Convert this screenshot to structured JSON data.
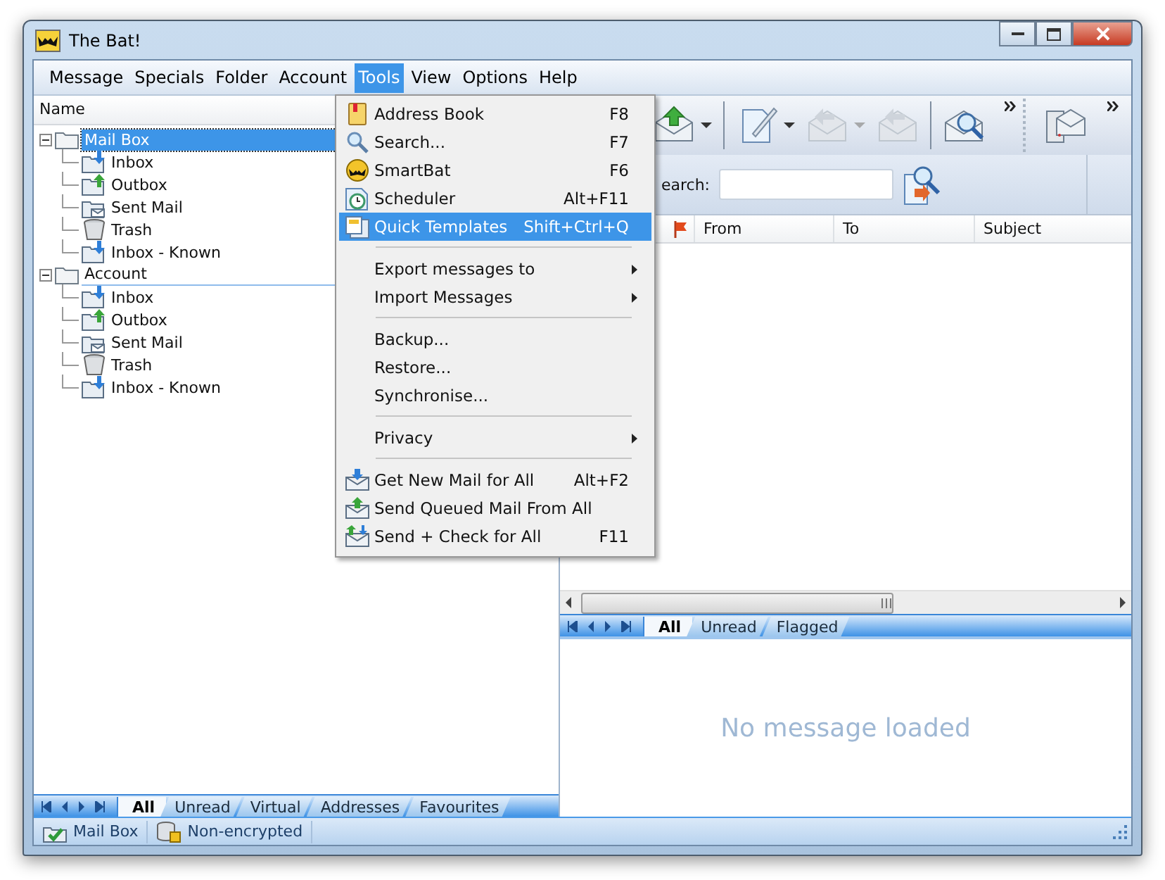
{
  "window": {
    "title": "The Bat!"
  },
  "menu_bar": [
    {
      "label": "Message",
      "selected": false
    },
    {
      "label": "Specials",
      "selected": false
    },
    {
      "label": "Folder",
      "selected": false
    },
    {
      "label": "Account",
      "selected": false
    },
    {
      "label": "Tools",
      "selected": true
    },
    {
      "label": "View",
      "selected": false
    },
    {
      "label": "Options",
      "selected": false
    },
    {
      "label": "Help",
      "selected": false
    }
  ],
  "folder_pane": {
    "header": "Name",
    "tree": [
      {
        "label": "Mail Box",
        "selected": true,
        "expanded": true,
        "children": [
          {
            "label": "Inbox",
            "selected": false
          },
          {
            "label": "Outbox",
            "selected": false
          },
          {
            "label": "Sent Mail",
            "selected": false
          },
          {
            "label": "Trash",
            "selected": false
          },
          {
            "label": "Inbox - Known",
            "selected": false
          }
        ]
      },
      {
        "label": "Account",
        "selected": false,
        "expanded": true,
        "children": [
          {
            "label": "Inbox",
            "selected": false
          },
          {
            "label": "Outbox",
            "selected": false
          },
          {
            "label": "Sent Mail",
            "selected": false
          },
          {
            "label": "Trash",
            "selected": false
          },
          {
            "label": "Inbox - Known",
            "selected": false
          }
        ]
      }
    ],
    "tabs": [
      {
        "label": "All",
        "selected": true
      },
      {
        "label": "Unread",
        "selected": false
      },
      {
        "label": "Virtual",
        "selected": false
      },
      {
        "label": "Addresses",
        "selected": false
      },
      {
        "label": "Favourites",
        "selected": false
      }
    ]
  },
  "toolbar": [
    {
      "disabled": false,
      "dropdown": true
    },
    {
      "disabled": false,
      "dropdown": true
    },
    {
      "disabled": true,
      "dropdown": true
    },
    {
      "disabled": true,
      "dropdown": false
    },
    {
      "disabled": false,
      "dropdown": false
    }
  ],
  "search": {
    "label": "earch:"
  },
  "message_list": {
    "columns": [
      "From",
      "To",
      "Subject"
    ],
    "tabs": [
      {
        "label": "All",
        "selected": true
      },
      {
        "label": "Unread",
        "selected": false
      },
      {
        "label": "Flagged",
        "selected": false
      }
    ]
  },
  "preview": {
    "empty_text": "No message loaded"
  },
  "tools_menu": [
    {
      "kind": "item",
      "label": "Address Book",
      "shortcut": "F8",
      "selected": false
    },
    {
      "kind": "item",
      "label": "Search...",
      "shortcut": "F7",
      "selected": false
    },
    {
      "kind": "item",
      "label": "SmartBat",
      "shortcut": "F6",
      "selected": false
    },
    {
      "kind": "item",
      "label": "Scheduler",
      "shortcut": "Alt+F11",
      "selected": false
    },
    {
      "kind": "item",
      "label": "Quick Templates",
      "shortcut": "Shift+Ctrl+Q",
      "selected": true
    },
    {
      "kind": "separator"
    },
    {
      "kind": "submenu",
      "label": "Export messages to",
      "selected": false
    },
    {
      "kind": "submenu",
      "label": "Import Messages",
      "selected": false
    },
    {
      "kind": "separator"
    },
    {
      "kind": "item",
      "label": "Backup...",
      "selected": false
    },
    {
      "kind": "item",
      "label": "Restore...",
      "selected": false
    },
    {
      "kind": "item",
      "label": "Synchronise...",
      "selected": false
    },
    {
      "kind": "separator"
    },
    {
      "kind": "submenu",
      "label": "Privacy",
      "selected": false
    },
    {
      "kind": "separator"
    },
    {
      "kind": "item",
      "label": "Get New Mail for All",
      "shortcut": "Alt+F2",
      "selected": false
    },
    {
      "kind": "item",
      "label": "Send Queued Mail From All",
      "selected": false
    },
    {
      "kind": "item",
      "label": "Send + Check for All",
      "shortcut": "F11",
      "selected": false
    }
  ],
  "status_bar": [
    {
      "label": "Mail Box"
    },
    {
      "label": "Non-encrypted"
    }
  ]
}
